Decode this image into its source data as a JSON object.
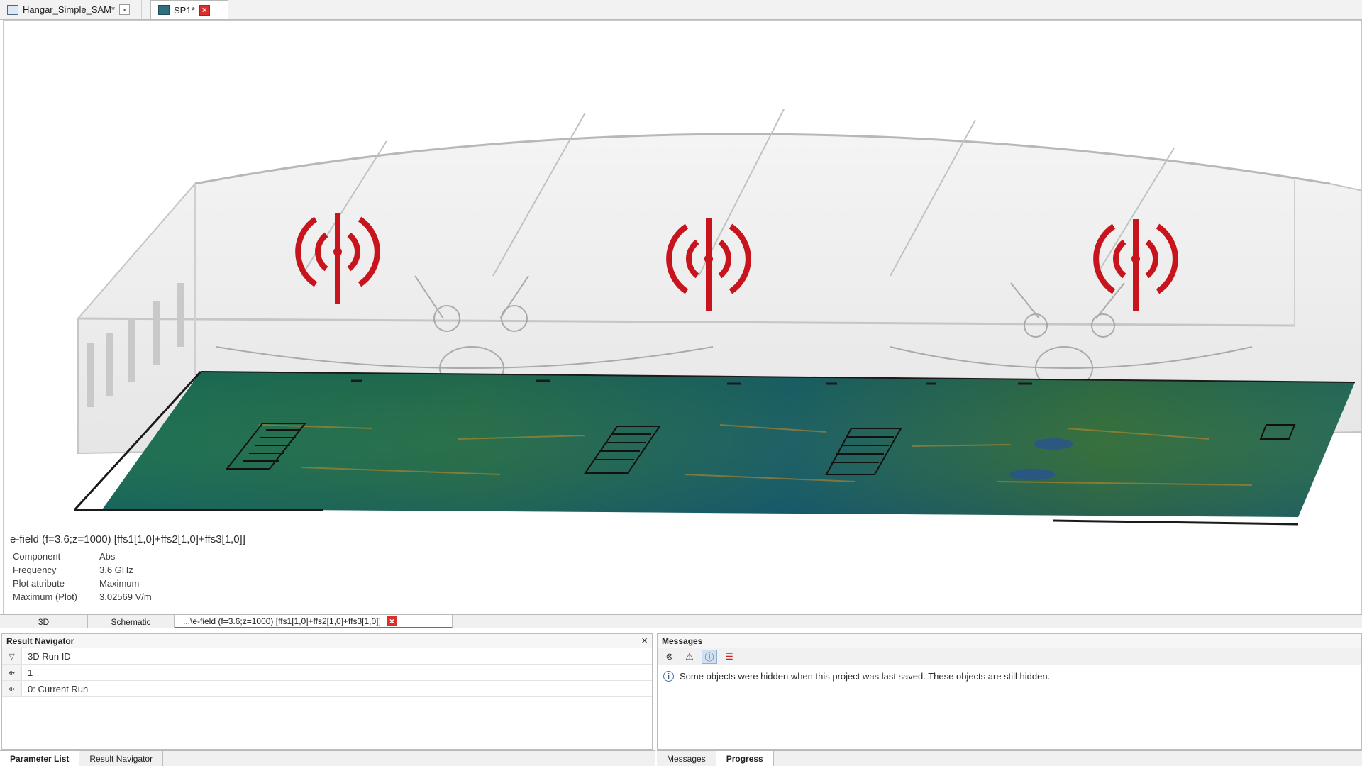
{
  "doc_tabs": [
    {
      "label": "Hangar_Simple_SAM*"
    },
    {
      "label": "SP1*"
    }
  ],
  "legend": {
    "title": "e-field (f=3.6;z=1000) [ffs1[1,0]+ffs2[1,0]+ffs3[1,0]]",
    "rows": [
      {
        "key": "Component",
        "value": "Abs"
      },
      {
        "key": "Frequency",
        "value": "3.6 GHz"
      },
      {
        "key": "Plot attribute",
        "value": "Maximum"
      },
      {
        "key": "Maximum (Plot)",
        "value": "3.02569 V/m"
      }
    ]
  },
  "view_tabs": {
    "tab_3d": "3D",
    "tab_schematic": "Schematic",
    "tab_efield": "...\\e-field (f=3.6;z=1000) [ffs1[1,0]+ffs2[1,0]+ffs3[1,0]]"
  },
  "result_navigator": {
    "title": "Result Navigator",
    "close": "×",
    "rows": [
      {
        "gutter": "▽",
        "text": "3D Run ID"
      },
      {
        "gutter": "⇹",
        "text": "1"
      },
      {
        "gutter": "⇹",
        "text": "0: Current Run"
      }
    ]
  },
  "messages": {
    "title": "Messages",
    "text": "Some objects were hidden when this project was last saved. These objects are still hidden."
  },
  "bottom_tabs_left": [
    "Parameter List",
    "Result Navigator"
  ],
  "bottom_tabs_right": [
    "Messages",
    "Progress"
  ],
  "colors": {
    "antenna": "#c8141c",
    "field_base": "#1f6e5d",
    "accent": "#3a78c8"
  }
}
